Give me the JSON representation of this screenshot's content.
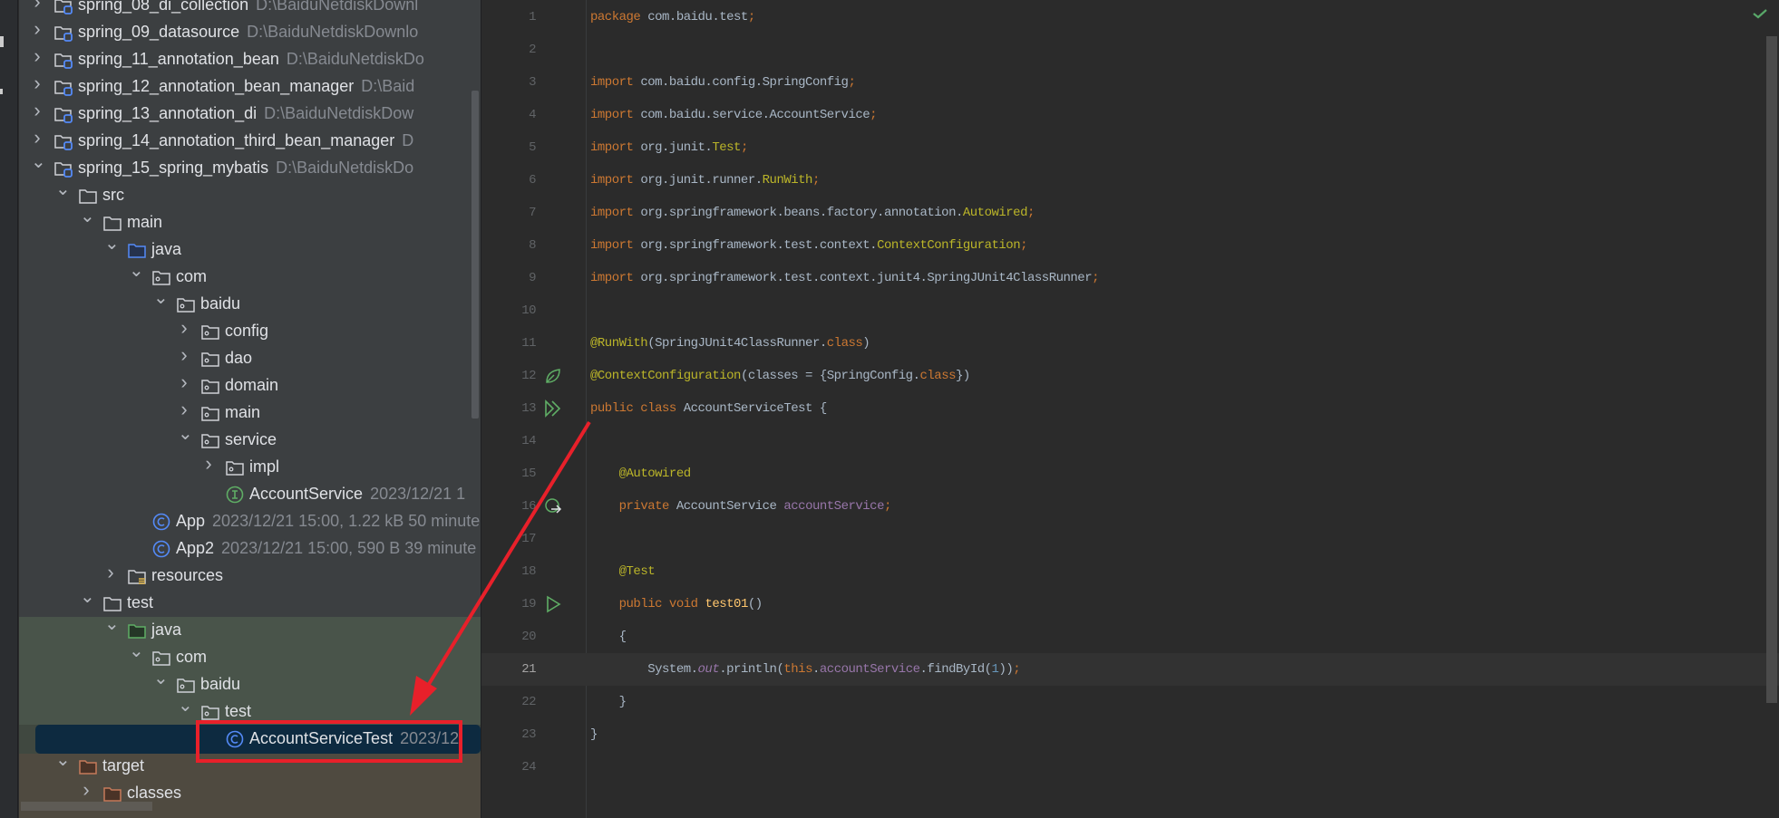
{
  "project_tree": {
    "items": [
      {
        "label": "spring_08_di_collection",
        "meta": "D:\\BaiduNetdiskDownl",
        "level": 0,
        "chevron": "right",
        "icon": "module"
      },
      {
        "label": "spring_09_datasource",
        "meta": "D:\\BaiduNetdiskDownlo",
        "level": 0,
        "chevron": "right",
        "icon": "module"
      },
      {
        "label": "spring_11_annotation_bean",
        "meta": "D:\\BaiduNetdiskDo",
        "level": 0,
        "chevron": "right",
        "icon": "module"
      },
      {
        "label": "spring_12_annotation_bean_manager",
        "meta": "D:\\Baid",
        "level": 0,
        "chevron": "right",
        "icon": "module"
      },
      {
        "label": "spring_13_annotation_di",
        "meta": "D:\\BaiduNetdiskDow",
        "level": 0,
        "chevron": "right",
        "icon": "module"
      },
      {
        "label": "spring_14_annotation_third_bean_manager",
        "meta": "D",
        "level": 0,
        "chevron": "right",
        "icon": "module"
      },
      {
        "label": "spring_15_spring_mybatis",
        "meta": "D:\\BaiduNetdiskDo",
        "level": 0,
        "chevron": "down",
        "icon": "module"
      },
      {
        "label": "src",
        "meta": "",
        "level": 1,
        "chevron": "down",
        "icon": "folder"
      },
      {
        "label": "main",
        "meta": "",
        "level": 2,
        "chevron": "down",
        "icon": "folder"
      },
      {
        "label": "java",
        "meta": "",
        "level": 3,
        "chevron": "down",
        "icon": "source-folder"
      },
      {
        "label": "com",
        "meta": "",
        "level": 4,
        "chevron": "down",
        "icon": "package"
      },
      {
        "label": "baidu",
        "meta": "",
        "level": 5,
        "chevron": "down",
        "icon": "package"
      },
      {
        "label": "config",
        "meta": "",
        "level": 6,
        "chevron": "right",
        "icon": "package"
      },
      {
        "label": "dao",
        "meta": "",
        "level": 6,
        "chevron": "right",
        "icon": "package"
      },
      {
        "label": "domain",
        "meta": "",
        "level": 6,
        "chevron": "right",
        "icon": "package"
      },
      {
        "label": "main",
        "meta": "",
        "level": 6,
        "chevron": "right",
        "icon": "package"
      },
      {
        "label": "service",
        "meta": "",
        "level": 6,
        "chevron": "down",
        "icon": "package"
      },
      {
        "label": "impl",
        "meta": "",
        "level": 7,
        "chevron": "right",
        "icon": "package"
      },
      {
        "label": "AccountService",
        "meta": "2023/12/21 1",
        "level": 7,
        "chevron": "",
        "icon": "interface"
      },
      {
        "label": "App",
        "meta": "2023/12/21 15:00, 1.22 kB 50 minute",
        "level": 4,
        "chevron": "",
        "icon": "class"
      },
      {
        "label": "App2",
        "meta": "2023/12/21 15:00, 590 B 39 minute",
        "level": 4,
        "chevron": "",
        "icon": "class"
      },
      {
        "label": "resources",
        "meta": "",
        "level": 3,
        "chevron": "right",
        "icon": "resources-folder"
      },
      {
        "label": "test",
        "meta": "",
        "level": 2,
        "chevron": "down",
        "icon": "folder"
      },
      {
        "label": "java",
        "meta": "",
        "level": 3,
        "chevron": "down",
        "icon": "test-folder"
      },
      {
        "label": "com",
        "meta": "",
        "level": 4,
        "chevron": "down",
        "icon": "package"
      },
      {
        "label": "baidu",
        "meta": "",
        "level": 5,
        "chevron": "down",
        "icon": "package"
      },
      {
        "label": "test",
        "meta": "",
        "level": 6,
        "chevron": "down",
        "icon": "package"
      },
      {
        "label": "AccountServiceTest",
        "meta": "2023/12",
        "level": 7,
        "chevron": "",
        "icon": "class",
        "selected": true
      },
      {
        "label": "target",
        "meta": "",
        "level": 1,
        "chevron": "down",
        "icon": "excluded-folder"
      },
      {
        "label": "classes",
        "meta": "",
        "level": 2,
        "chevron": "right",
        "icon": "excluded-folder"
      }
    ]
  },
  "editor": {
    "status_icon": "check-icon",
    "current_line": 21,
    "lines": [
      {
        "n": "1",
        "tokens": [
          [
            "package ",
            "kw"
          ],
          [
            "com.baidu.test",
            ""
          ],
          [
            ";",
            "semi"
          ]
        ]
      },
      {
        "n": "2",
        "tokens": []
      },
      {
        "n": "3",
        "tokens": [
          [
            "import ",
            "kw"
          ],
          [
            "com.baidu.config.SpringConfig",
            ""
          ],
          [
            ";",
            "semi"
          ]
        ]
      },
      {
        "n": "4",
        "tokens": [
          [
            "import ",
            "kw"
          ],
          [
            "com.baidu.service.AccountService",
            ""
          ],
          [
            ";",
            "semi"
          ]
        ]
      },
      {
        "n": "5",
        "tokens": [
          [
            "import ",
            "kw"
          ],
          [
            "org.junit.",
            ""
          ],
          [
            "Test",
            "an"
          ],
          [
            ";",
            "semi"
          ]
        ]
      },
      {
        "n": "6",
        "tokens": [
          [
            "import ",
            "kw"
          ],
          [
            "org.junit.runner.",
            ""
          ],
          [
            "RunWith",
            "an"
          ],
          [
            ";",
            "semi"
          ]
        ]
      },
      {
        "n": "7",
        "tokens": [
          [
            "import ",
            "kw"
          ],
          [
            "org.springframework.beans.factory.annotation.",
            ""
          ],
          [
            "Autowired",
            "an"
          ],
          [
            ";",
            "semi"
          ]
        ]
      },
      {
        "n": "8",
        "tokens": [
          [
            "import ",
            "kw"
          ],
          [
            "org.springframework.test.context.",
            ""
          ],
          [
            "ContextConfiguration",
            "an"
          ],
          [
            ";",
            "semi"
          ]
        ]
      },
      {
        "n": "9",
        "tokens": [
          [
            "import ",
            "kw"
          ],
          [
            "org.springframework.test.context.junit4.SpringJUnit4ClassRunner",
            ""
          ],
          [
            ";",
            "semi"
          ]
        ]
      },
      {
        "n": "10",
        "tokens": []
      },
      {
        "n": "11",
        "tokens": [
          [
            "@RunWith",
            "an"
          ],
          [
            "(SpringJUnit4ClassRunner.",
            ""
          ],
          [
            "class",
            "kw"
          ],
          [
            ")",
            ""
          ]
        ]
      },
      {
        "n": "12",
        "gutter": "spring-bean-icon",
        "tokens": [
          [
            "@ContextConfiguration",
            "an"
          ],
          [
            "(classes = {SpringConfig.",
            ""
          ],
          [
            "class",
            "kw"
          ],
          [
            "})",
            ""
          ]
        ]
      },
      {
        "n": "13",
        "gutter": "run-all-icon",
        "tokens": [
          [
            "public class ",
            "kw"
          ],
          [
            "AccountServiceTest {",
            ""
          ]
        ]
      },
      {
        "n": "14",
        "tokens": []
      },
      {
        "n": "15",
        "tokens": [
          [
            "    ",
            ""
          ],
          [
            "@Autowired",
            "an"
          ]
        ]
      },
      {
        "n": "16",
        "gutter": "autowired-icon",
        "tokens": [
          [
            "    ",
            ""
          ],
          [
            "private ",
            "kw"
          ],
          [
            "AccountService ",
            ""
          ],
          [
            "accountService",
            "fld"
          ],
          [
            ";",
            "semi"
          ]
        ]
      },
      {
        "n": "17",
        "tokens": []
      },
      {
        "n": "18",
        "tokens": [
          [
            "    ",
            ""
          ],
          [
            "@Test",
            "an"
          ]
        ]
      },
      {
        "n": "19",
        "gutter": "run-icon",
        "tokens": [
          [
            "    ",
            ""
          ],
          [
            "public void ",
            "kw"
          ],
          [
            "test01",
            "fn"
          ],
          [
            "()",
            ""
          ]
        ]
      },
      {
        "n": "20",
        "tokens": [
          [
            "    {",
            ""
          ]
        ]
      },
      {
        "n": "21",
        "tokens": [
          [
            "        System.",
            ""
          ],
          [
            "out",
            "it"
          ],
          [
            ".println(",
            ""
          ],
          [
            "this",
            "kw"
          ],
          [
            ".",
            ""
          ],
          [
            "accountService",
            "fld"
          ],
          [
            ".findById(",
            ""
          ],
          [
            "1",
            "num"
          ],
          [
            "))",
            ""
          ],
          [
            ";",
            "semi"
          ]
        ]
      },
      {
        "n": "22",
        "tokens": [
          [
            "    }",
            ""
          ]
        ]
      },
      {
        "n": "23",
        "tokens": [
          [
            "}",
            ""
          ]
        ]
      },
      {
        "n": "24",
        "tokens": []
      }
    ]
  },
  "annotation": {
    "color": "#e8202a",
    "target": "AccountServiceTest"
  }
}
